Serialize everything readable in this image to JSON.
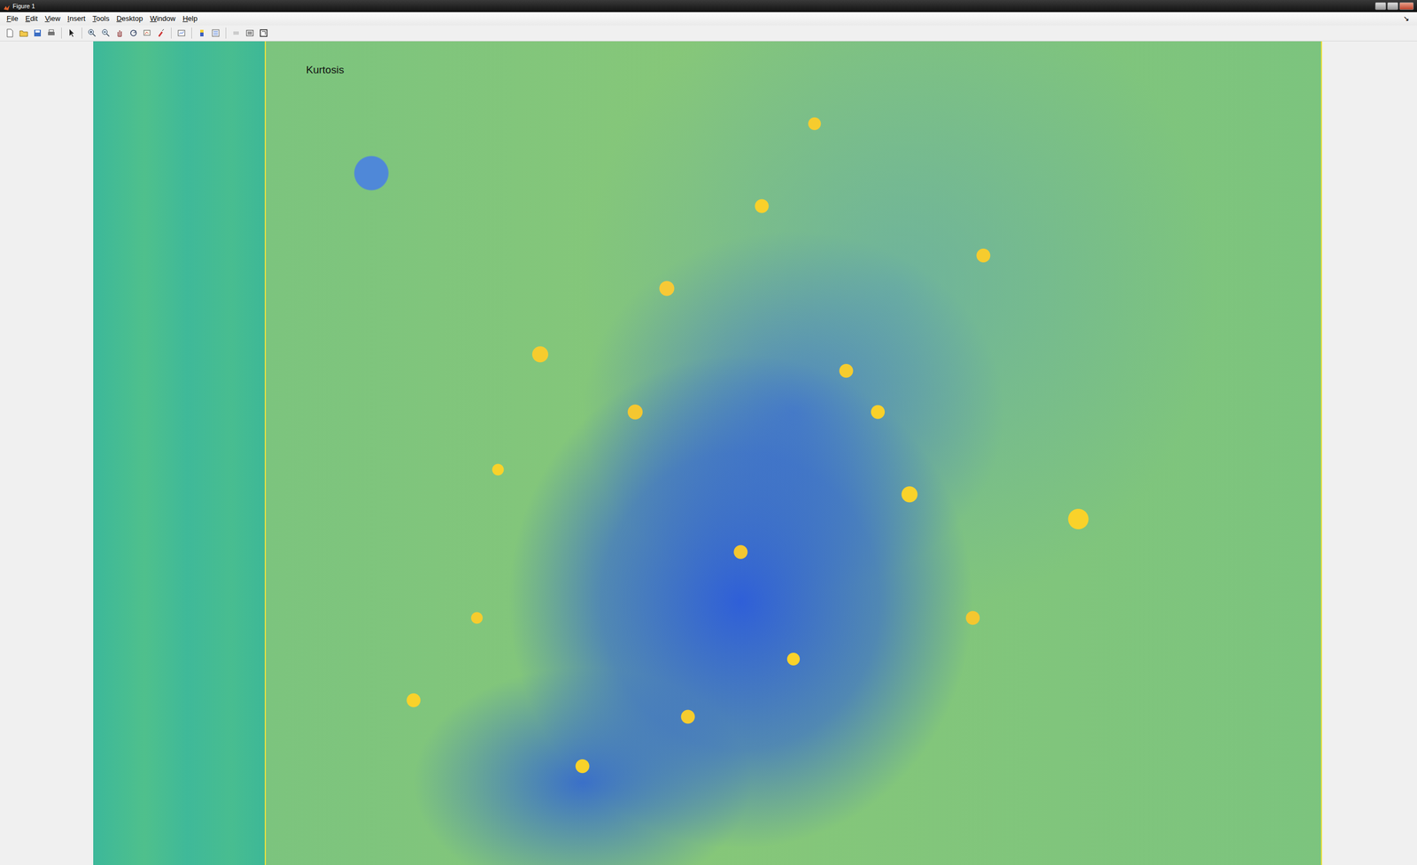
{
  "window": {
    "title": "Figure 1"
  },
  "menu": [
    {
      "label": "File"
    },
    {
      "label": "Edit"
    },
    {
      "label": "View"
    },
    {
      "label": "Insert"
    },
    {
      "label": "Tools"
    },
    {
      "label": "Desktop"
    },
    {
      "label": "Window"
    },
    {
      "label": "Help"
    }
  ],
  "dock": "↘",
  "figure": {
    "annotation": "Kurtosis"
  }
}
